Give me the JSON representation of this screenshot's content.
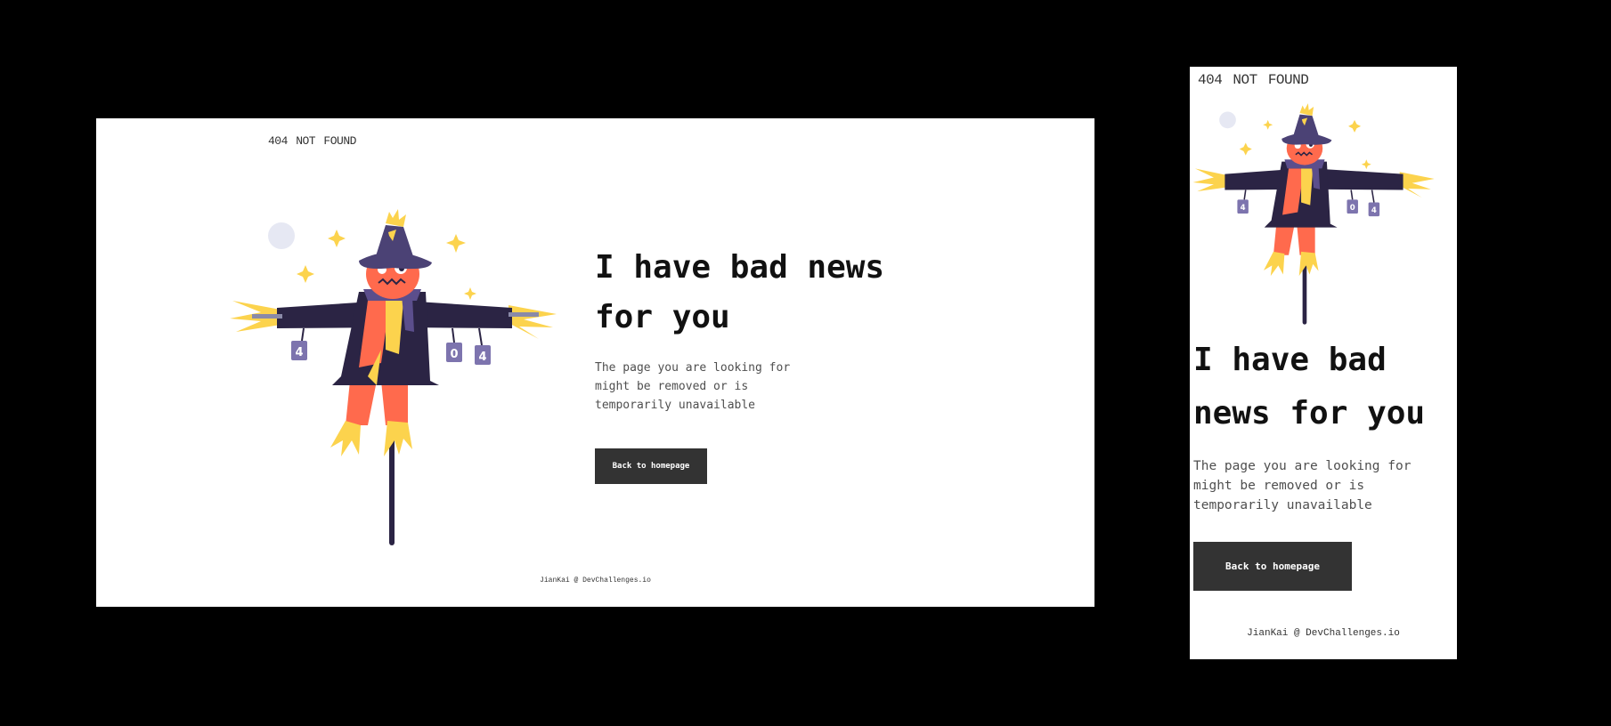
{
  "desktop": {
    "brand": "404 NOT FOUND",
    "headline": "I have bad news for you",
    "description": "The page you are looking for might be removed or is temporarily unavailable",
    "button_label": "Back to homepage",
    "footer": "JianKai @ DevChallenges.io"
  },
  "mobile": {
    "brand": "404 NOT FOUND",
    "headline": "I have bad news for you",
    "description": "The page you are looking for might be removed or is temporarily unavailable",
    "button_label": "Back to homepage",
    "footer": "JianKai @ DevChallenges.io"
  },
  "illustration": {
    "name": "scarecrow-illustration",
    "tag_text": [
      "4",
      "0",
      "4"
    ]
  },
  "colors": {
    "background": "#000000",
    "page": "#ffffff",
    "button": "#333333",
    "text": "#333333",
    "coat": "#2b2444",
    "hat": "#4b4275",
    "skin": "#ff6a4d",
    "straw": "#fcd34d",
    "scarf": "#5b4e8c"
  }
}
